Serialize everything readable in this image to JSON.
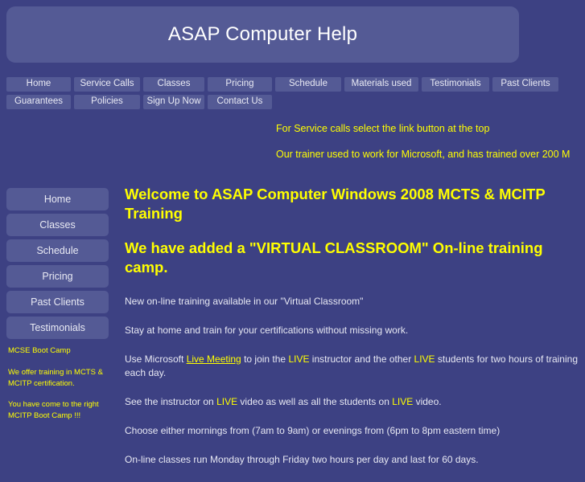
{
  "colors": {
    "page_background": "#3d4183",
    "panel": "#545a95",
    "accent_yellow": "#ffff00",
    "text_white": "#ffffff",
    "body_text": "#e7e8f3"
  },
  "banner": {
    "title": "ASAP Computer Help"
  },
  "topnav": {
    "row1": [
      {
        "label": "Home"
      },
      {
        "label": "Service Calls"
      },
      {
        "label": "Classes"
      },
      {
        "label": "Pricing"
      },
      {
        "label": "Schedule"
      },
      {
        "label": "Materials used"
      },
      {
        "label": "Testimonials"
      },
      {
        "label": "Past Clients"
      }
    ],
    "row2": [
      {
        "label": "Guarantees"
      },
      {
        "label": "Policies"
      },
      {
        "label": "Sign Up Now"
      },
      {
        "label": "Contact Us"
      }
    ]
  },
  "notices": [
    "For Service calls select the link button at the top",
    "Our trainer used to work for Microsoft, and has trained over 200 M"
  ],
  "sidebar": {
    "buttons": [
      {
        "label": "Home"
      },
      {
        "label": "Classes"
      },
      {
        "label": "Schedule"
      },
      {
        "label": "Pricing"
      },
      {
        "label": "Past Clients"
      },
      {
        "label": "Testimonials"
      }
    ],
    "notes": [
      "MCSE Boot Camp",
      "We offer training in MCTS & MCITP certification.",
      "You have come to the right MCITP Boot Camp !!!"
    ]
  },
  "main": {
    "heading1": "Welcome to ASAP Computer Windows 2008 MCTS & MCITP Training",
    "heading2": "We have added a \"VIRTUAL CLASSROOM\" On-line training camp.",
    "para1": "New on-line training available in our \"Virtual Classroom\"",
    "para2": "Stay at home and train for your certifications without missing work.",
    "para3": {
      "seg1": "Use Microsoft ",
      "link": "Live Meeting",
      "seg2": " to join the ",
      "live1": "LIVE",
      "seg3": " instructor and the other ",
      "live2": "LIVE",
      "seg4": " students for two hours of training each day."
    },
    "para4": {
      "seg1": "See the instructor on ",
      "live1": "LIVE",
      "seg2": " video as well as all the students on ",
      "live2": "LIVE",
      "seg3": " video."
    },
    "para5": "Choose either mornings from (7am to 9am) or evenings from (6pm to 8pm eastern time)",
    "para6": "On-line classes run Monday through Friday two hours per day and last for 60 days."
  }
}
